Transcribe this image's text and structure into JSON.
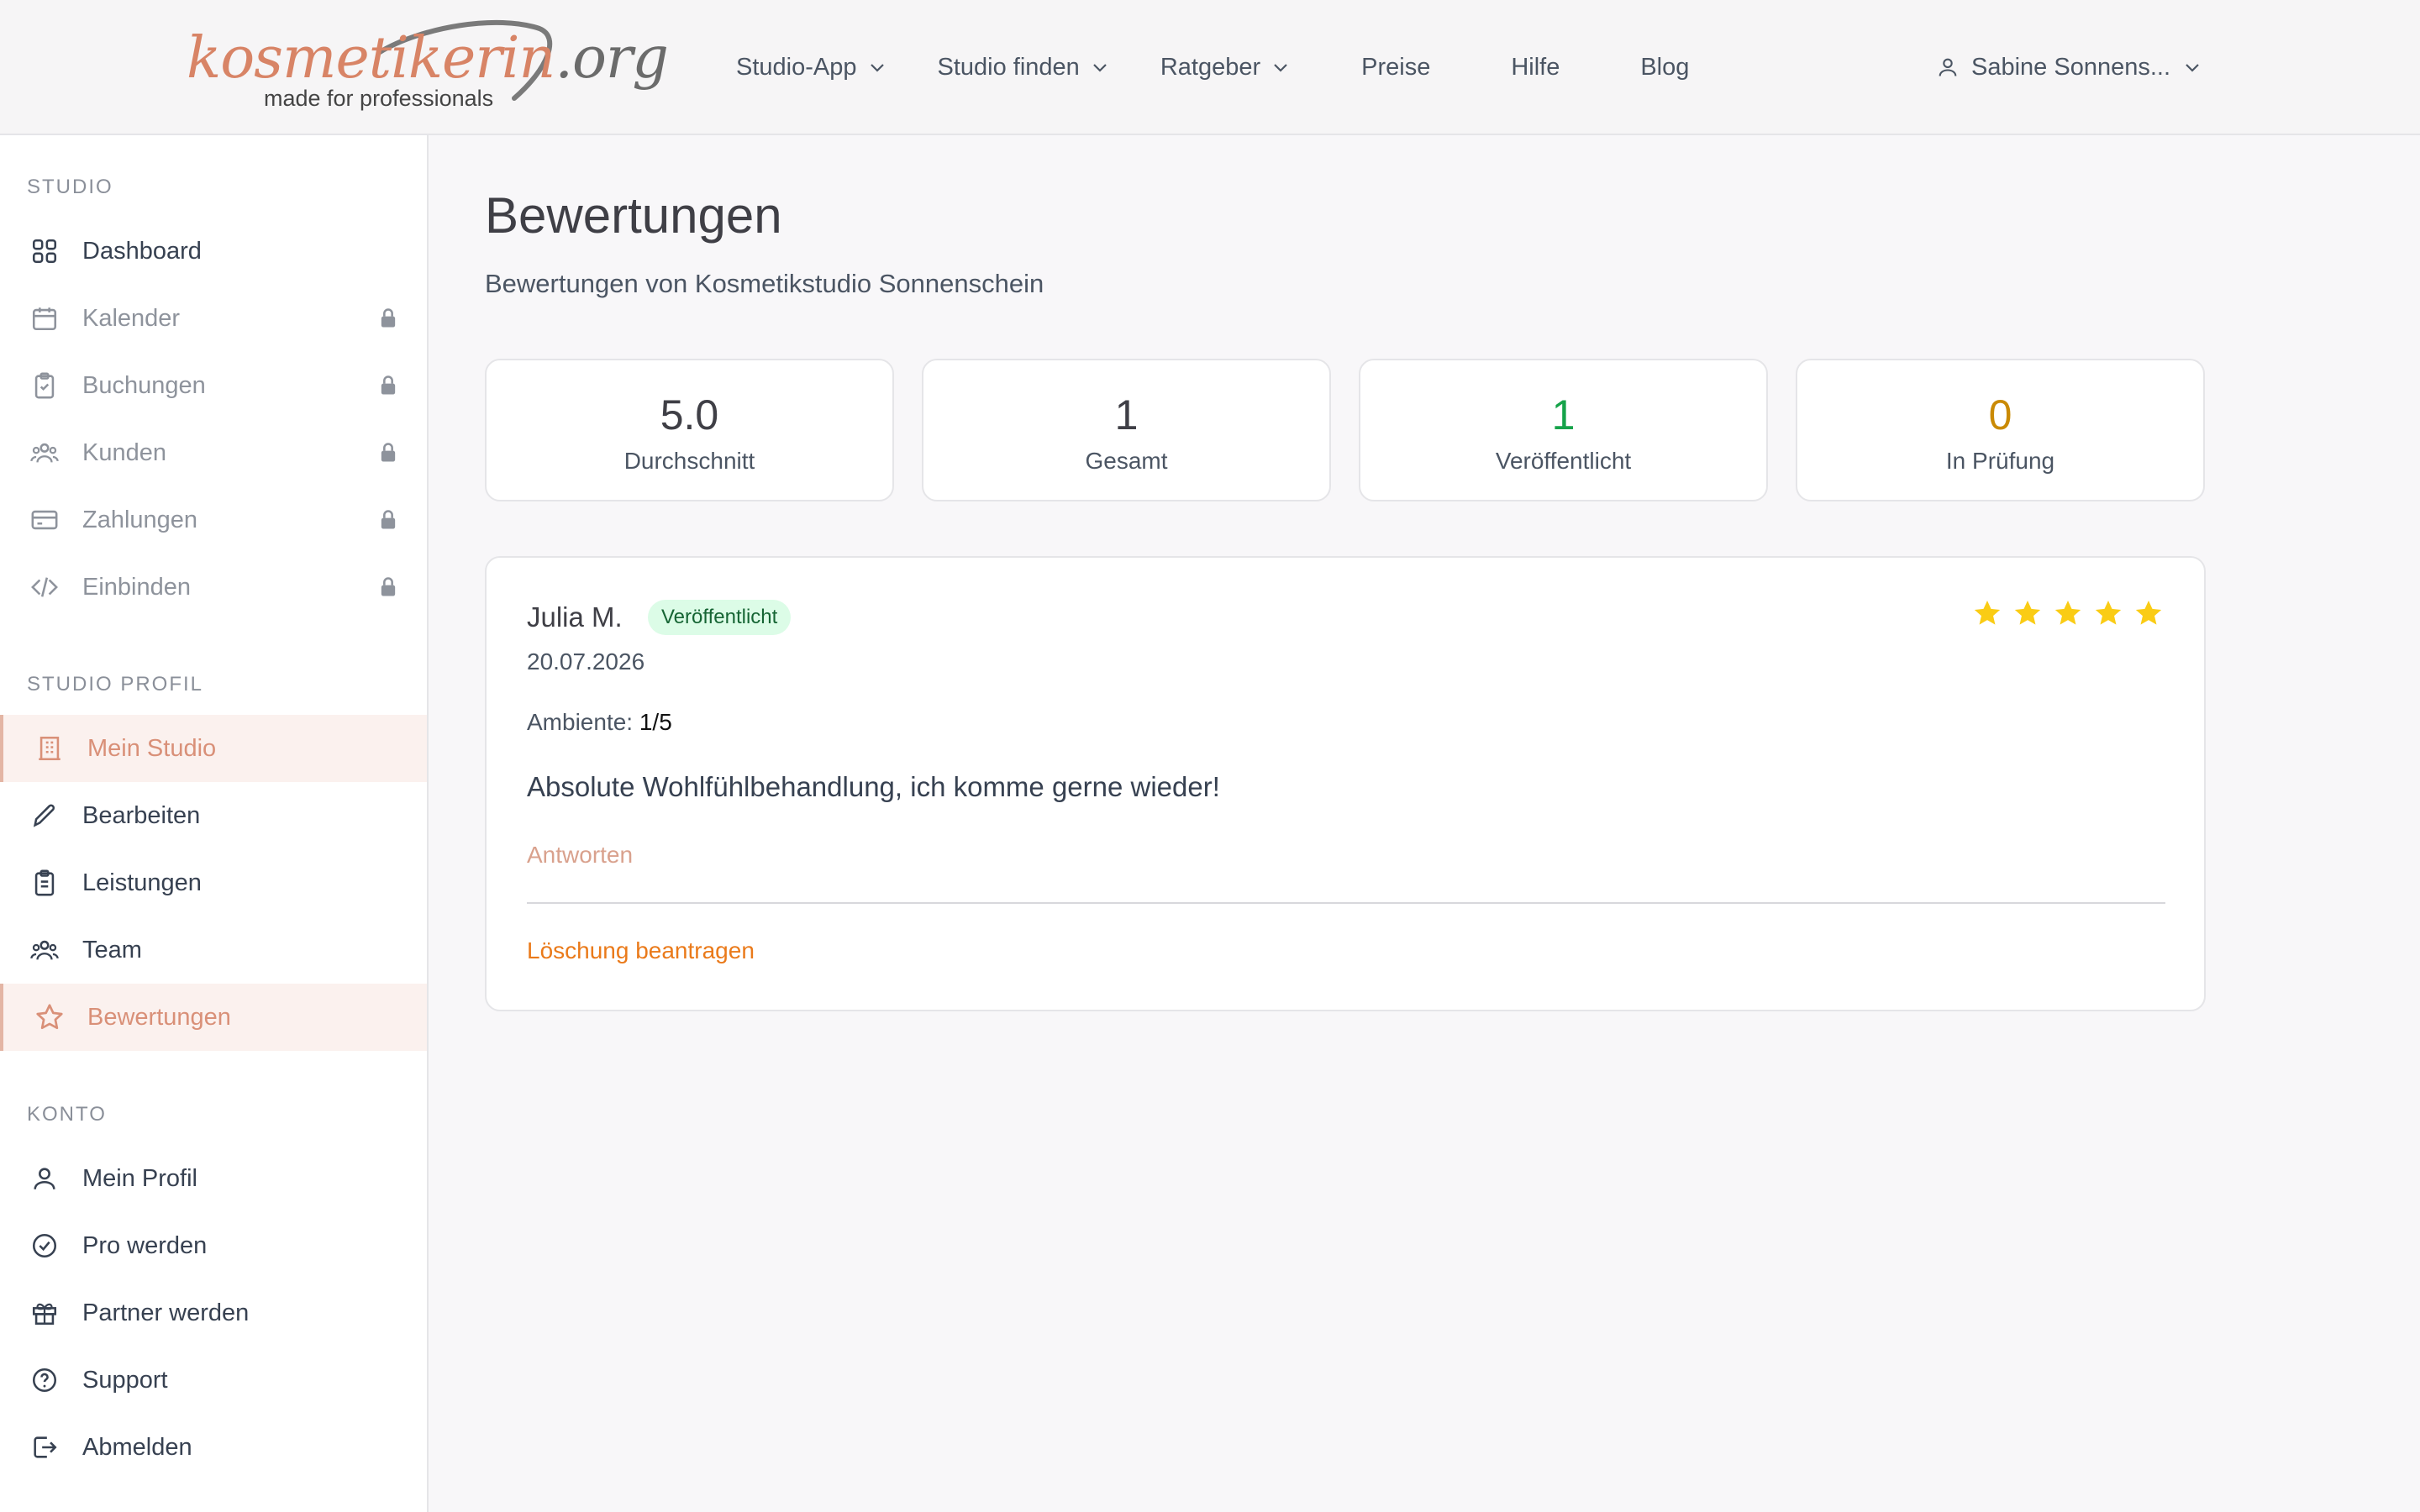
{
  "header": {
    "logo": {
      "wordmark": "kosmetikerin",
      "tld": ".org",
      "tagline": "made for professionals"
    },
    "nav": [
      {
        "label": "Studio-App",
        "has_dropdown": true
      },
      {
        "label": "Studio finden",
        "has_dropdown": true
      },
      {
        "label": "Ratgeber",
        "has_dropdown": true
      },
      {
        "label": "Preise",
        "has_dropdown": false
      },
      {
        "label": "Hilfe",
        "has_dropdown": false
      },
      {
        "label": "Blog",
        "has_dropdown": false
      }
    ],
    "user": {
      "name": "Sabine Sonnens...",
      "icon": "user-icon"
    }
  },
  "sidebar": {
    "sections": [
      {
        "title": "STUDIO",
        "items": [
          {
            "label": "Dashboard",
            "icon": "grid-icon",
            "locked": false,
            "active": false
          },
          {
            "label": "Kalender",
            "icon": "calendar-icon",
            "locked": true,
            "active": false
          },
          {
            "label": "Buchungen",
            "icon": "clipboard-check-icon",
            "locked": true,
            "active": false
          },
          {
            "label": "Kunden",
            "icon": "users-icon",
            "locked": true,
            "active": false
          },
          {
            "label": "Zahlungen",
            "icon": "credit-card-icon",
            "locked": true,
            "active": false
          },
          {
            "label": "Einbinden",
            "icon": "code-icon",
            "locked": true,
            "active": false
          }
        ]
      },
      {
        "title": "STUDIO PROFIL",
        "items": [
          {
            "label": "Mein Studio",
            "icon": "building-icon",
            "locked": false,
            "active": true
          },
          {
            "label": "Bearbeiten",
            "icon": "pencil-icon",
            "locked": false,
            "active": false
          },
          {
            "label": "Leistungen",
            "icon": "clipboard-list-icon",
            "locked": false,
            "active": false
          },
          {
            "label": "Team",
            "icon": "users-icon",
            "locked": false,
            "active": false
          },
          {
            "label": "Bewertungen",
            "icon": "star-outline-icon",
            "locked": false,
            "active": true
          }
        ]
      },
      {
        "title": "KONTO",
        "items": [
          {
            "label": "Mein Profil",
            "icon": "user-icon",
            "locked": false,
            "active": false
          },
          {
            "label": "Pro werden",
            "icon": "badge-check-icon",
            "locked": false,
            "active": false
          },
          {
            "label": "Partner werden",
            "icon": "gift-icon",
            "locked": false,
            "active": false
          },
          {
            "label": "Support",
            "icon": "help-circle-icon",
            "locked": false,
            "active": false
          },
          {
            "label": "Abmelden",
            "icon": "logout-icon",
            "locked": false,
            "active": false
          }
        ]
      }
    ]
  },
  "main": {
    "title": "Bewertungen",
    "subtitle": "Bewertungen von Kosmetikstudio Sonnenschein",
    "stats": [
      {
        "value": "5.0",
        "label": "Durchschnitt",
        "color": "#3f3f46"
      },
      {
        "value": "1",
        "label": "Gesamt",
        "color": "#3f3f46"
      },
      {
        "value": "1",
        "label": "Veröffentlicht",
        "color": "#16a34a"
      },
      {
        "value": "0",
        "label": "In Prüfung",
        "color": "#ca8a04"
      }
    ],
    "review": {
      "author": "Julia M.",
      "status": "Veröffentlicht",
      "date": "20.07.2026",
      "rating": 5,
      "rating_max": 5,
      "ambiente_label": "Ambiente:",
      "ambiente_value": "1/5",
      "text": "Absolute Wohlfühlbehandlung, ich komme gerne wieder!",
      "reply_label": "Antworten",
      "delete_label": "Löschung beantragen"
    }
  },
  "colors": {
    "accent": "#d99078",
    "published": "#16a34a",
    "pending": "#ca8a04",
    "star": "#facc15",
    "delete": "#ea7a1a"
  }
}
